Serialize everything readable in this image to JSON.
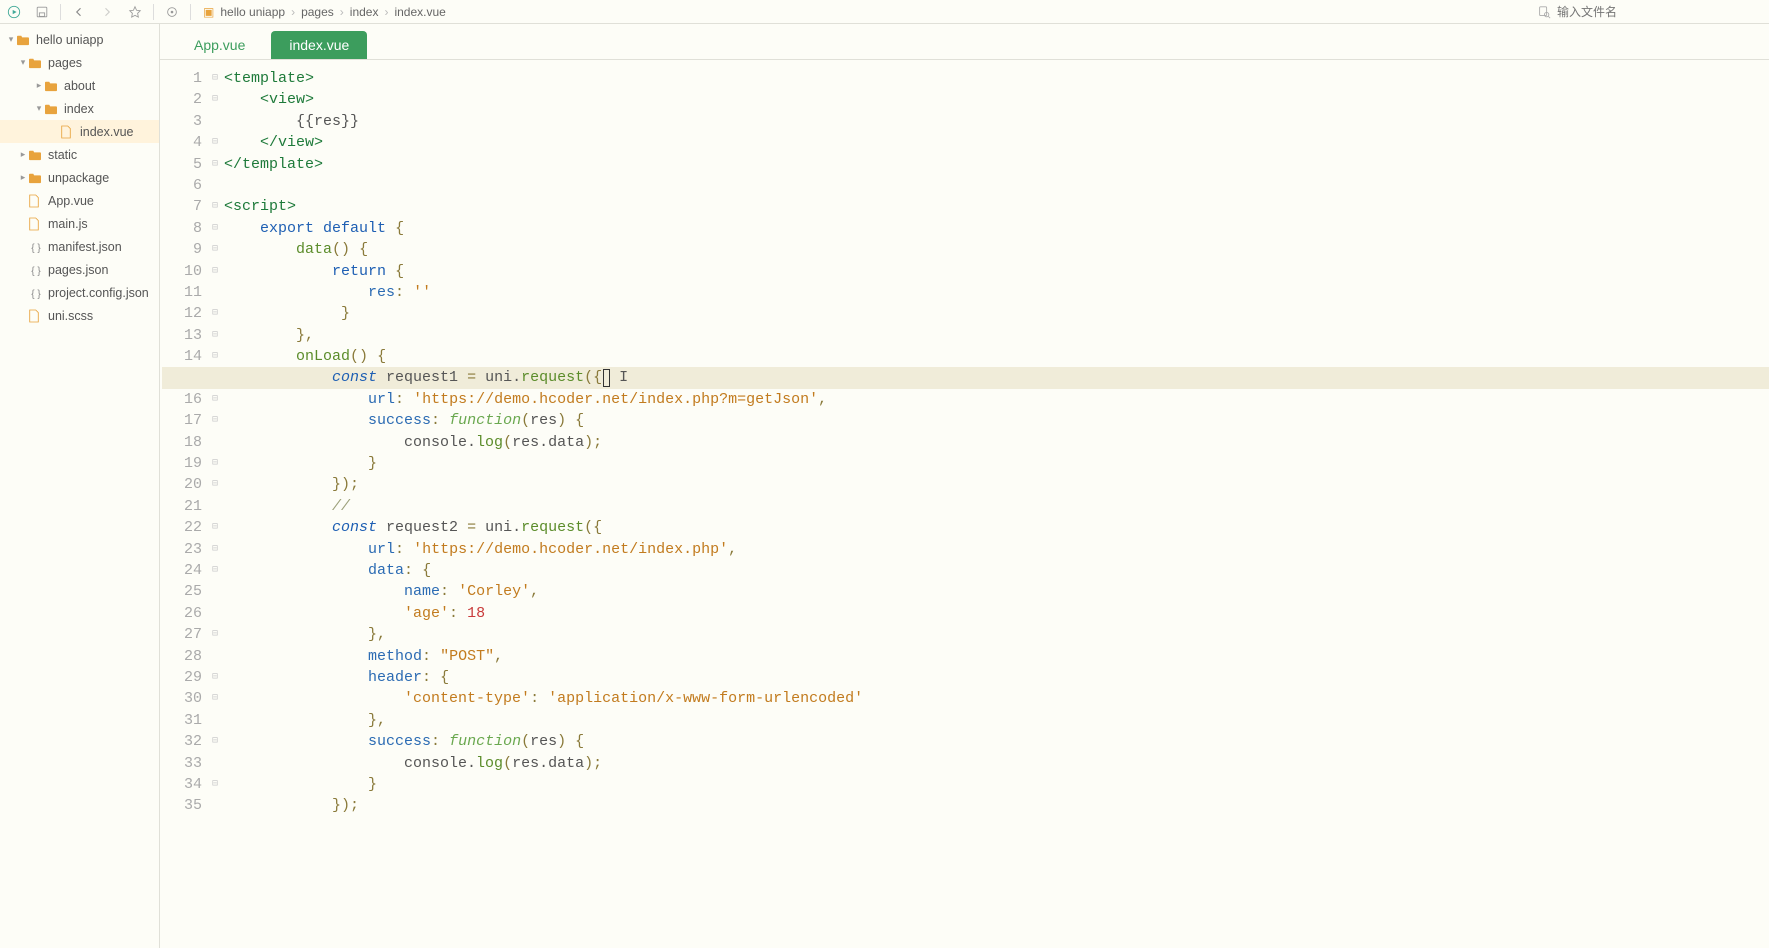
{
  "toolbar": {
    "search_placeholder": "输入文件名"
  },
  "breadcrumbs": [
    {
      "icon": "folder",
      "label": "hello uniapp"
    },
    {
      "icon": "none",
      "label": "pages"
    },
    {
      "icon": "none",
      "label": "index"
    },
    {
      "icon": "none",
      "label": "index.vue"
    }
  ],
  "tree": [
    {
      "indent": 0,
      "chev": "▾",
      "icon": "folder",
      "label": "hello uniapp",
      "selected": false
    },
    {
      "indent": 1,
      "chev": "▾",
      "icon": "folder",
      "label": "pages",
      "selected": false
    },
    {
      "indent": 2,
      "chev": "▸",
      "icon": "folder",
      "label": "about",
      "selected": false
    },
    {
      "indent": 2,
      "chev": "▾",
      "icon": "folder",
      "label": "index",
      "selected": false
    },
    {
      "indent": 3,
      "chev": "",
      "icon": "file-vue",
      "label": "index.vue",
      "selected": true
    },
    {
      "indent": 1,
      "chev": "▸",
      "icon": "folder",
      "label": "static",
      "selected": false
    },
    {
      "indent": 1,
      "chev": "▸",
      "icon": "folder",
      "label": "unpackage",
      "selected": false
    },
    {
      "indent": 1,
      "chev": "",
      "icon": "file-vue",
      "label": "App.vue",
      "selected": false
    },
    {
      "indent": 1,
      "chev": "",
      "icon": "file-js",
      "label": "main.js",
      "selected": false
    },
    {
      "indent": 1,
      "chev": "",
      "icon": "file-json",
      "label": "manifest.json",
      "selected": false
    },
    {
      "indent": 1,
      "chev": "",
      "icon": "file-json",
      "label": "pages.json",
      "selected": false
    },
    {
      "indent": 1,
      "chev": "",
      "icon": "file-json",
      "label": "project.config.json",
      "selected": false
    },
    {
      "indent": 1,
      "chev": "",
      "icon": "file-js",
      "label": "uni.scss",
      "selected": false
    }
  ],
  "tabs": [
    {
      "label": "App.vue",
      "active": false
    },
    {
      "label": "index.vue",
      "active": true
    }
  ],
  "code": {
    "line_count": 35,
    "highlighted_line": 15,
    "fold_lines": [
      1,
      2,
      4,
      5,
      7,
      8,
      9,
      10,
      12,
      13,
      14,
      15,
      16,
      17,
      19,
      20,
      22,
      23,
      24,
      27,
      29,
      30,
      32,
      34
    ],
    "lines": [
      [
        [
          "tag",
          "<template>"
        ]
      ],
      [
        [
          "plain",
          "    "
        ],
        [
          "tag",
          "<view>"
        ]
      ],
      [
        [
          "plain",
          "        {{res}}"
        ]
      ],
      [
        [
          "plain",
          "    "
        ],
        [
          "tag",
          "</view>"
        ]
      ],
      [
        [
          "tag",
          "</template>"
        ]
      ],
      [
        [
          "plain",
          ""
        ]
      ],
      [
        [
          "tag",
          "<script>"
        ]
      ],
      [
        [
          "plain",
          "    "
        ],
        [
          "kw",
          "export"
        ],
        [
          "plain",
          " "
        ],
        [
          "kw",
          "default"
        ],
        [
          "plain",
          " "
        ],
        [
          "punc",
          "{"
        ]
      ],
      [
        [
          "plain",
          "        "
        ],
        [
          "fnname",
          "data"
        ],
        [
          "punc",
          "()"
        ],
        [
          "plain",
          " "
        ],
        [
          "punc",
          "{"
        ]
      ],
      [
        [
          "plain",
          "            "
        ],
        [
          "kw",
          "return"
        ],
        [
          "plain",
          " "
        ],
        [
          "punc",
          "{"
        ]
      ],
      [
        [
          "plain",
          "                "
        ],
        [
          "prop",
          "res"
        ],
        [
          "punc",
          ":"
        ],
        [
          "plain",
          " "
        ],
        [
          "str",
          "''"
        ]
      ],
      [
        [
          "plain",
          "             "
        ],
        [
          "punc",
          "}"
        ]
      ],
      [
        [
          "plain",
          "        "
        ],
        [
          "punc",
          "},"
        ]
      ],
      [
        [
          "plain",
          "        "
        ],
        [
          "fnname",
          "onLoad"
        ],
        [
          "punc",
          "()"
        ],
        [
          "plain",
          " "
        ],
        [
          "punc",
          "{"
        ]
      ],
      [
        [
          "plain",
          "            "
        ],
        [
          "const",
          "const"
        ],
        [
          "plain",
          " request1 "
        ],
        [
          "punc",
          "="
        ],
        [
          "plain",
          " uni."
        ],
        [
          "fnname",
          "request"
        ],
        [
          "punc",
          "({"
        ],
        [
          "cursor",
          ""
        ],
        [
          "plain",
          " "
        ],
        [
          "plain",
          "I"
        ]
      ],
      [
        [
          "plain",
          "                "
        ],
        [
          "prop",
          "url"
        ],
        [
          "punc",
          ":"
        ],
        [
          "plain",
          " "
        ],
        [
          "str",
          "'https://demo.hcoder.net/index.php?m=getJson'"
        ],
        [
          "punc",
          ","
        ]
      ],
      [
        [
          "plain",
          "                "
        ],
        [
          "prop",
          "success"
        ],
        [
          "punc",
          ":"
        ],
        [
          "plain",
          " "
        ],
        [
          "fn",
          "function"
        ],
        [
          "punc",
          "("
        ],
        [
          "plain",
          "res"
        ],
        [
          "punc",
          ")"
        ],
        [
          "plain",
          " "
        ],
        [
          "punc",
          "{"
        ]
      ],
      [
        [
          "plain",
          "                    console."
        ],
        [
          "fnname",
          "log"
        ],
        [
          "punc",
          "("
        ],
        [
          "plain",
          "res.data"
        ],
        [
          "punc",
          ");"
        ]
      ],
      [
        [
          "plain",
          "                "
        ],
        [
          "punc",
          "}"
        ]
      ],
      [
        [
          "plain",
          "            "
        ],
        [
          "punc",
          "});"
        ]
      ],
      [
        [
          "plain",
          "            "
        ],
        [
          "comm",
          "//"
        ]
      ],
      [
        [
          "plain",
          "            "
        ],
        [
          "const",
          "const"
        ],
        [
          "plain",
          " request2 "
        ],
        [
          "punc",
          "="
        ],
        [
          "plain",
          " uni."
        ],
        [
          "fnname",
          "request"
        ],
        [
          "punc",
          "({"
        ]
      ],
      [
        [
          "plain",
          "                "
        ],
        [
          "prop",
          "url"
        ],
        [
          "punc",
          ":"
        ],
        [
          "plain",
          " "
        ],
        [
          "str",
          "'https://demo.hcoder.net/index.php'"
        ],
        [
          "punc",
          ","
        ]
      ],
      [
        [
          "plain",
          "                "
        ],
        [
          "prop",
          "data"
        ],
        [
          "punc",
          ":"
        ],
        [
          "plain",
          " "
        ],
        [
          "punc",
          "{"
        ]
      ],
      [
        [
          "plain",
          "                    "
        ],
        [
          "prop",
          "name"
        ],
        [
          "punc",
          ":"
        ],
        [
          "plain",
          " "
        ],
        [
          "str",
          "'Corley'"
        ],
        [
          "punc",
          ","
        ]
      ],
      [
        [
          "plain",
          "                    "
        ],
        [
          "str",
          "'age'"
        ],
        [
          "punc",
          ":"
        ],
        [
          "plain",
          " "
        ],
        [
          "num",
          "18"
        ]
      ],
      [
        [
          "plain",
          "                "
        ],
        [
          "punc",
          "},"
        ]
      ],
      [
        [
          "plain",
          "                "
        ],
        [
          "prop",
          "method"
        ],
        [
          "punc",
          ":"
        ],
        [
          "plain",
          " "
        ],
        [
          "str",
          "\"POST\""
        ],
        [
          "punc",
          ","
        ]
      ],
      [
        [
          "plain",
          "                "
        ],
        [
          "prop",
          "header"
        ],
        [
          "punc",
          ":"
        ],
        [
          "plain",
          " "
        ],
        [
          "punc",
          "{"
        ]
      ],
      [
        [
          "plain",
          "                    "
        ],
        [
          "str",
          "'content-type'"
        ],
        [
          "punc",
          ":"
        ],
        [
          "plain",
          " "
        ],
        [
          "str",
          "'application/x-www-form-urlencoded'"
        ]
      ],
      [
        [
          "plain",
          "                "
        ],
        [
          "punc",
          "},"
        ]
      ],
      [
        [
          "plain",
          "                "
        ],
        [
          "prop",
          "success"
        ],
        [
          "punc",
          ":"
        ],
        [
          "plain",
          " "
        ],
        [
          "fn",
          "function"
        ],
        [
          "punc",
          "("
        ],
        [
          "plain",
          "res"
        ],
        [
          "punc",
          ")"
        ],
        [
          "plain",
          " "
        ],
        [
          "punc",
          "{"
        ]
      ],
      [
        [
          "plain",
          "                    console."
        ],
        [
          "fnname",
          "log"
        ],
        [
          "punc",
          "("
        ],
        [
          "plain",
          "res.data"
        ],
        [
          "punc",
          ");"
        ]
      ],
      [
        [
          "plain",
          "                "
        ],
        [
          "punc",
          "}"
        ]
      ],
      [
        [
          "plain",
          "            "
        ],
        [
          "punc",
          "});"
        ]
      ]
    ]
  }
}
